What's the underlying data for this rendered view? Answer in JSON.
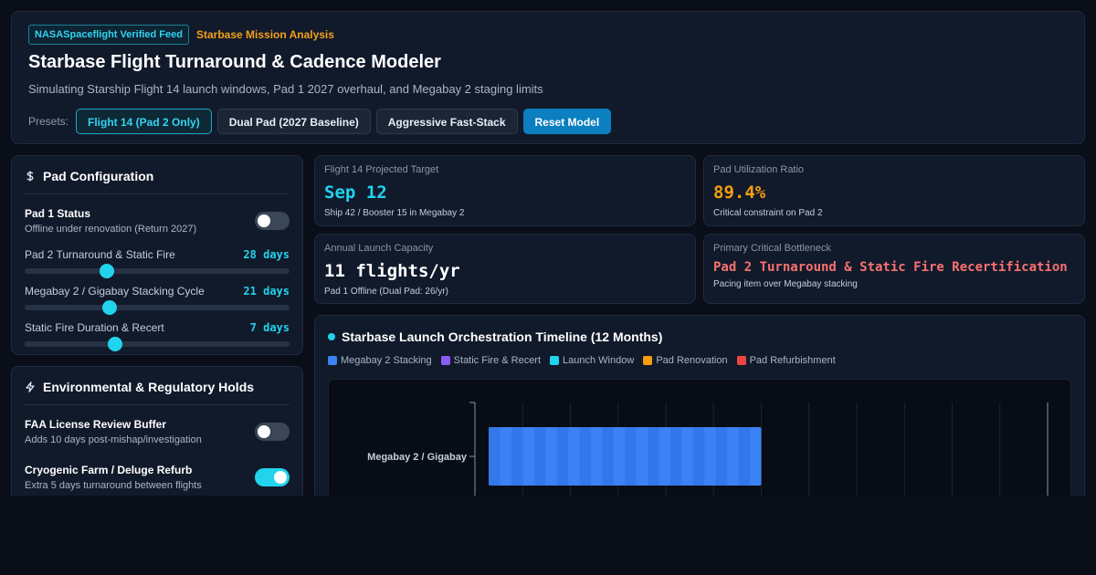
{
  "header": {
    "feed_badge": "NASASpaceflight Verified Feed",
    "analysis_label": "Starbase Mission Analysis",
    "title": "Starbase Flight Turnaround & Cadence Modeler",
    "subtitle": "Simulating Starship Flight 14 launch windows, Pad 1 2027 overhaul, and Megabay 2 staging limits"
  },
  "presets": {
    "label": "Presets:",
    "flight14": "Flight 14 (Pad 2 Only)",
    "dual_pad": "Dual Pad (2027 Baseline)",
    "fast_stack": "Aggressive Fast-Stack",
    "reset": "Reset Model",
    "active": "flight14"
  },
  "pad_config": {
    "title": "Pad Configuration",
    "icon": "dollar-icon",
    "pad1": {
      "name": "Pad 1 Status",
      "desc": "Offline under renovation (Return 2027)",
      "on": false
    },
    "sliders": [
      {
        "label": "Pad 2 Turnaround & Static Fire",
        "value": "28 days",
        "level": 0.31
      },
      {
        "label": "Megabay 2 / Gigabay Stacking Cycle",
        "value": "21 days",
        "level": 0.32
      },
      {
        "label": "Static Fire Duration & Recert",
        "value": "7 days",
        "level": 0.34
      }
    ]
  },
  "env": {
    "title": "Environmental & Regulatory Holds",
    "icon": "lightning-icon",
    "faa": {
      "name": "FAA License Review Buffer",
      "desc": "Adds 10 days post-mishap/investigation",
      "on": false
    },
    "cryo": {
      "name": "Cryogenic Farm / Deluge Refurb",
      "desc": "Extra 5 days turnaround between flights",
      "on": true
    }
  },
  "stats": {
    "target": {
      "title": "Flight 14 Projected Target",
      "value": "Sep 12",
      "sub": "Ship 42 / Booster 15 in Megabay 2",
      "color": "#22d3ee"
    },
    "util": {
      "title": "Pad Utilization Ratio",
      "value": "89.4%",
      "sub": "Critical constraint on Pad 2",
      "color": "#f59e0b"
    },
    "capacity": {
      "title": "Annual Launch Capacity",
      "value": "11 flights/yr",
      "sub": "Pad 1 Offline (Dual Pad: 26/yr)",
      "color": "#ffffff"
    },
    "bottleneck": {
      "title": "Primary Critical Bottleneck",
      "value": "Pad 2 Turnaround & Static Fire Recertification",
      "sub": "Pacing item over Megabay stacking",
      "color": "#f87171"
    }
  },
  "timeline": {
    "title": "Starbase Launch Orchestration Timeline (12 Months)",
    "legend": [
      {
        "label": "Megabay 2 Stacking",
        "color": "#3b82f6"
      },
      {
        "label": "Static Fire & Recert",
        "color": "#8b5cf6"
      },
      {
        "label": "Launch Window",
        "color": "#22d3ee"
      },
      {
        "label": "Pad Renovation",
        "color": "#f59e0b"
      },
      {
        "label": "Pad Refurbishment",
        "color": "#ef4444"
      }
    ],
    "rows": [
      {
        "label": "Megabay 2 / Gigabay"
      }
    ],
    "months": 12,
    "stacking_segments": 12,
    "stacking_end_month": 6
  }
}
